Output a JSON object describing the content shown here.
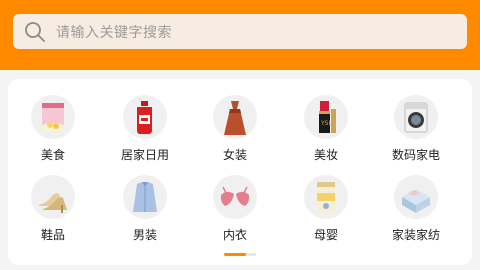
{
  "search": {
    "placeholder": "请输入关键字搜索",
    "icon": "search-icon"
  },
  "categories": [
    {
      "label": "美食",
      "icon": "food-icon"
    },
    {
      "label": "居家日用",
      "icon": "household-icon"
    },
    {
      "label": "女装",
      "icon": "womens-dress-icon"
    },
    {
      "label": "美妆",
      "icon": "cosmetics-icon"
    },
    {
      "label": "数码家电",
      "icon": "appliance-icon"
    },
    {
      "label": "鞋品",
      "icon": "shoes-icon"
    },
    {
      "label": "男装",
      "icon": "mens-shirt-icon"
    },
    {
      "label": "内衣",
      "icon": "underwear-icon"
    },
    {
      "label": "母婴",
      "icon": "baby-formula-icon"
    },
    {
      "label": "家装家纺",
      "icon": "bedding-icon"
    }
  ],
  "colors": {
    "header": "#ff8a00",
    "indicator_active": "#ff8a00"
  },
  "pager": {
    "pages": 2,
    "current": 1
  }
}
